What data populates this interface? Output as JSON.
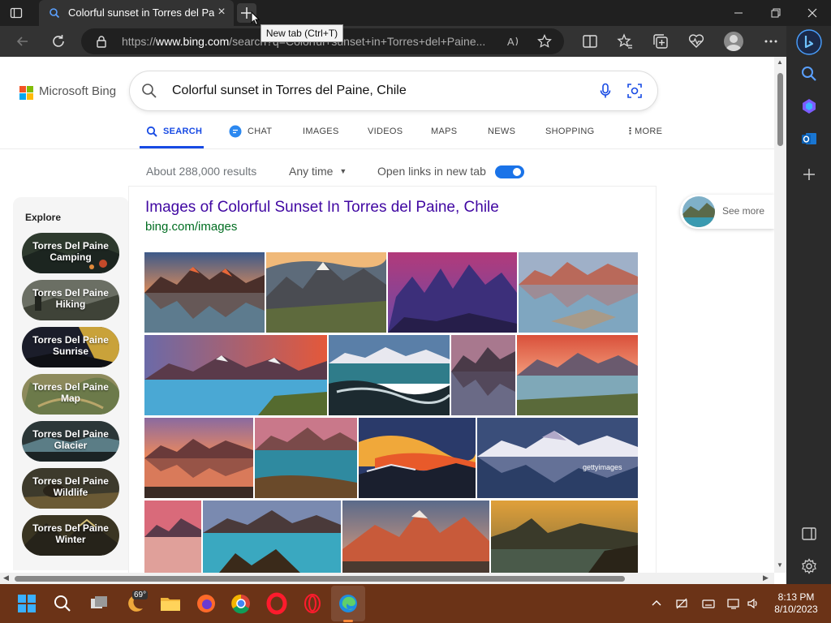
{
  "browser": {
    "tab_title": "Colorful sunset in Torres del Paine",
    "new_tab_tooltip": "New tab (Ctrl+T)",
    "url_prefix": "https://",
    "url_domain": "www.bing.com",
    "url_rest": "/search?q=Colorful+sunset+in+Torres+del+Paine..."
  },
  "bing": {
    "logo_text": "Microsoft Bing",
    "query": "Colorful sunset in Torres del Paine, Chile",
    "nav_tabs": [
      {
        "label": "SEARCH",
        "active": true
      },
      {
        "label": "CHAT"
      },
      {
        "label": "IMAGES"
      },
      {
        "label": "VIDEOS"
      },
      {
        "label": "MAPS"
      },
      {
        "label": "NEWS"
      },
      {
        "label": "SHOPPING"
      },
      {
        "label": "MORE"
      }
    ],
    "results_count": "About 288,000 results",
    "time_filter": "Any time",
    "open_links_label": "Open links in new tab",
    "open_links_on": true
  },
  "explore": {
    "title": "Explore",
    "items": [
      "Torres Del Paine Camping",
      "Torres Del Paine Hiking",
      "Torres Del Paine Sunrise",
      "Torres Del Paine Map",
      "Torres Del Paine Glacier",
      "Torres Del Paine Wildlife",
      "Torres Del Paine Winter"
    ]
  },
  "result": {
    "title": "Images of Colorful Sunset In Torres del Paine, Chile",
    "url": "bing.com/images",
    "see_more": "See more"
  },
  "taskbar": {
    "weather_temp": "69°",
    "time": "8:13 PM",
    "date": "8/10/2023"
  },
  "colors": {
    "accent": "#174ae4",
    "link_title": "#4007a2",
    "link_url": "#006d21",
    "taskbar": "#6b3317"
  }
}
